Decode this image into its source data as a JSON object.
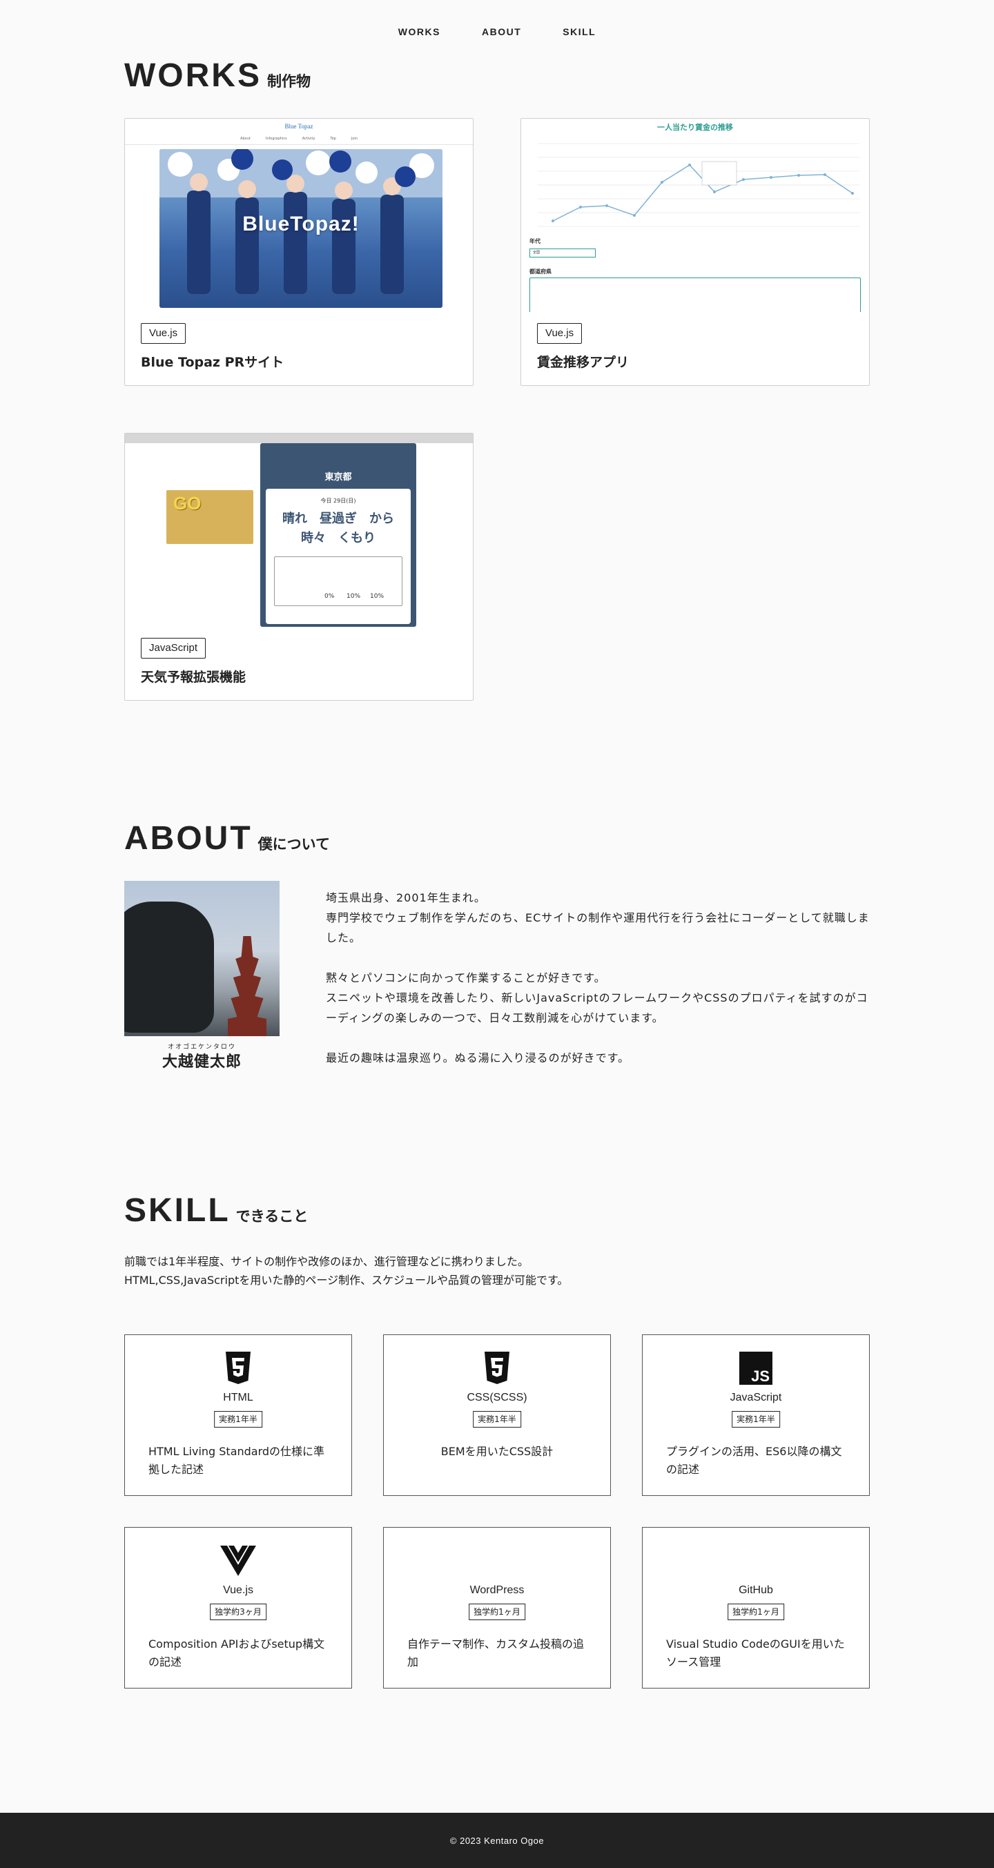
{
  "nav": {
    "items": [
      "WORKS",
      "ABOUT",
      "SKILL"
    ]
  },
  "works": {
    "title_en": "WORKS",
    "title_ja": "制作物",
    "cards": [
      {
        "tag": "Vue.js",
        "title": "Blue Topaz PRサイト",
        "thumb_logo": "Blue Topaz",
        "thumb_nav": [
          "About",
          "Infographics",
          "Activity",
          "Top",
          "Join"
        ],
        "thumb_overlay": "BlueTopaz!"
      },
      {
        "tag": "Vue.js",
        "title": "賃金推移アプリ",
        "thumb_title": "一人当たり賃金の推移",
        "thumb_label_1": "年代",
        "thumb_select": "全国",
        "thumb_label_2": "都道府県"
      },
      {
        "tag": "JavaScript",
        "title": "天気予報拡張機能",
        "thumb_city": "東京都",
        "thumb_date": "今日 29日(日)",
        "thumb_forecast_1": "晴れ　昼過ぎ　から",
        "thumb_forecast_2": "時々　くもり",
        "thumb_pct": [
          "0%",
          "10%",
          "10%"
        ],
        "thumb_go": "GO"
      }
    ]
  },
  "about": {
    "title_en": "ABOUT",
    "title_ja": "僕について",
    "ruby": "オオゴエケンタロウ",
    "name": "大越健太郎",
    "bio": [
      "埼玉県出身、2001年生まれ。\n専門学校でウェブ制作を学んだのち、ECサイトの制作や運用代行を行う会社にコーダーとして就職しました。",
      "黙々とパソコンに向かって作業することが好きです。\nスニペットや環境を改善したり、新しいJavaScriptのフレームワークやCSSのプロパティを試すのがコーディングの楽しみの一つで、日々工数削減を心がけています。",
      "最近の趣味は温泉巡り。ぬる湯に入り浸るのが好きです。"
    ]
  },
  "skill": {
    "title_en": "SKILL",
    "title_ja": "できること",
    "intro_1": "前職では1年半程度、サイトの制作や改修のほか、進行管理などに携わりました。",
    "intro_2": "HTML,CSS,JavaScriptを用いた静的ページ制作、スケジュールや品質の管理が可能です。",
    "items": [
      {
        "icon": "html5-icon",
        "name": "HTML",
        "years": "実務1年半",
        "desc": "HTML Living Standardの仕様に準拠した記述"
      },
      {
        "icon": "css3-icon",
        "name": "CSS(SCSS)",
        "years": "実務1年半",
        "desc": "BEMを用いたCSS設計"
      },
      {
        "icon": "javascript-icon",
        "name": "JavaScript",
        "years": "実務1年半",
        "desc": "プラグインの活用、ES6以降の構文の記述"
      },
      {
        "icon": "vue-icon",
        "name": "Vue.js",
        "years": "独学約3ヶ月",
        "desc": "Composition APIおよびsetup構文の記述"
      },
      {
        "icon": "wordpress-icon",
        "name": "WordPress",
        "years": "独学約1ヶ月",
        "desc": "自作テーマ制作、カスタム投稿の追加"
      },
      {
        "icon": "github-icon",
        "name": "GitHub",
        "years": "独学約1ヶ月",
        "desc": "Visual Studio CodeのGUIを用いたソース管理"
      }
    ]
  },
  "footer": {
    "copyright": "© 2023 Kentaro Ogoe"
  }
}
